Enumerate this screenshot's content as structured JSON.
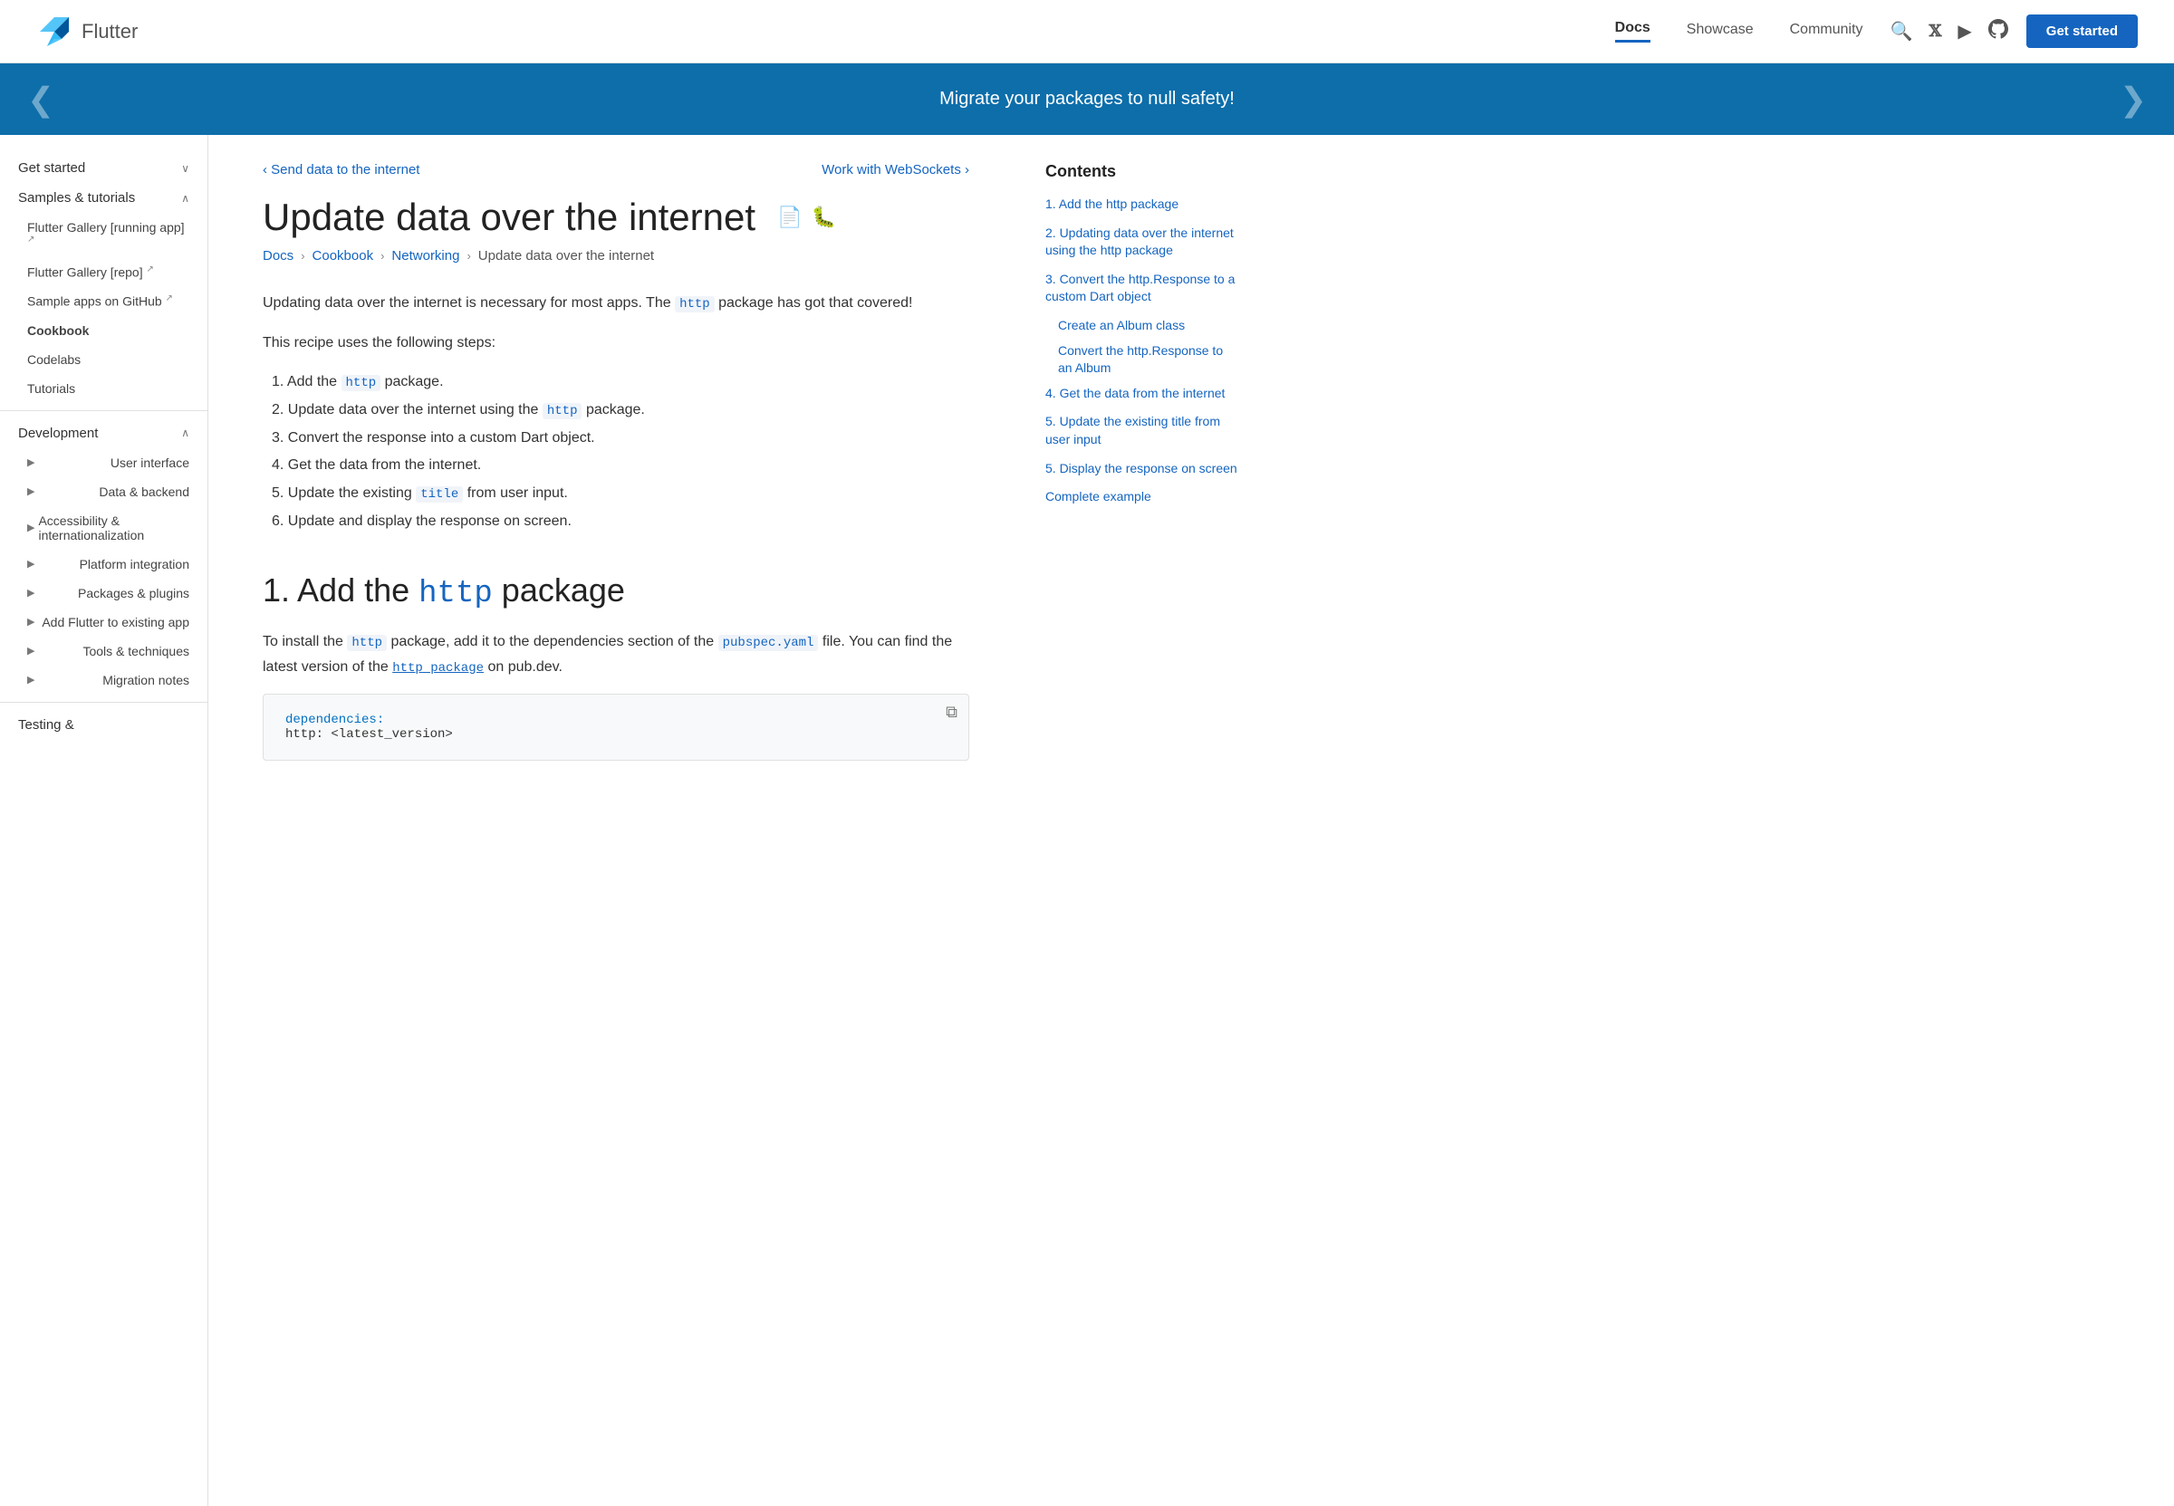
{
  "header": {
    "logo_text": "Flutter",
    "nav": [
      {
        "label": "Docs",
        "active": true,
        "id": "docs"
      },
      {
        "label": "Showcase",
        "active": false,
        "id": "showcase"
      },
      {
        "label": "Community",
        "active": false,
        "id": "community"
      }
    ],
    "get_started_label": "Get started"
  },
  "banner": {
    "text": "Migrate your packages to null safety!"
  },
  "sidebar": {
    "items": [
      {
        "label": "Get started",
        "type": "top",
        "expanded": false
      },
      {
        "label": "Samples & tutorials",
        "type": "top",
        "expanded": true
      },
      {
        "label": "Flutter Gallery [running app]",
        "type": "sub",
        "ext": true
      },
      {
        "label": "Flutter Gallery [repo]",
        "type": "sub",
        "ext": true
      },
      {
        "label": "Sample apps on GitHub",
        "type": "sub",
        "ext": true
      },
      {
        "label": "Cookbook",
        "type": "sub",
        "active": true
      },
      {
        "label": "Codelabs",
        "type": "sub"
      },
      {
        "label": "Tutorials",
        "type": "sub"
      },
      {
        "label": "Development",
        "type": "top",
        "expanded": true
      },
      {
        "label": "User interface",
        "type": "sub-arrow"
      },
      {
        "label": "Data & backend",
        "type": "sub-arrow"
      },
      {
        "label": "Accessibility & internationalization",
        "type": "sub-arrow"
      },
      {
        "label": "Platform integration",
        "type": "sub-arrow"
      },
      {
        "label": "Packages & plugins",
        "type": "sub-arrow"
      },
      {
        "label": "Add Flutter to existing app",
        "type": "sub-arrow"
      },
      {
        "label": "Tools & techniques",
        "type": "sub-arrow"
      },
      {
        "label": "Migration notes",
        "type": "sub-arrow"
      },
      {
        "label": "Testing &",
        "type": "top-partial"
      }
    ]
  },
  "page_nav": {
    "prev_label": "Send data to the internet",
    "next_label": "Work with WebSockets"
  },
  "page_title": "Update data over the internet",
  "breadcrumb": [
    {
      "label": "Docs",
      "href": "#"
    },
    {
      "label": "Cookbook",
      "href": "#"
    },
    {
      "label": "Networking",
      "href": "#"
    },
    {
      "label": "Update data over the internet",
      "current": true
    }
  ],
  "intro_text": "Updating data over the internet is necessary for most apps. The http package has got that covered!",
  "recipe_intro": "This recipe uses the following steps:",
  "steps": [
    "1. Add the http package.",
    "2. Update data over the internet using the http package.",
    "3. Convert the response into a custom Dart object.",
    "4. Get the data from the internet.",
    "5. Update the existing title from user input.",
    "6. Update and display the response on screen."
  ],
  "section1_title_prefix": "1. Add the ",
  "section1_title_code": "http",
  "section1_title_suffix": " package",
  "section1_text1_prefix": "To install the ",
  "section1_text1_code1": "http",
  "section1_text1_middle": " package, add it to the dependencies section of the ",
  "section1_text1_code2": "pubspec.yaml",
  "section1_text1_suffix": " file. You can find the latest version of the ",
  "section1_text1_code3": "http package",
  "section1_text1_end": " on pub.dev.",
  "code_block": {
    "line1": "dependencies:",
    "line2": "  http: <latest_version>"
  },
  "toc": {
    "title": "Contents",
    "items": [
      {
        "label": "1. Add the http package",
        "sub": false
      },
      {
        "label": "2. Updating data over the internet using the http package",
        "sub": false
      },
      {
        "label": "3. Convert the http.Response to a custom Dart object",
        "sub": false
      },
      {
        "label": "Create an Album class",
        "sub": true
      },
      {
        "label": "Convert the http.Response to an Album",
        "sub": true
      },
      {
        "label": "4. Get the data from the internet",
        "sub": false
      },
      {
        "label": "5. Update the existing title from user input",
        "sub": false
      },
      {
        "label": "5. Display the response on screen",
        "sub": false
      },
      {
        "label": "Complete example",
        "sub": false
      }
    ]
  },
  "icons": {
    "search": "🔍",
    "twitter": "𝕏",
    "youtube": "▶",
    "github": "⚙",
    "doc": "📄",
    "bug": "🐛",
    "copy": "⧉",
    "chevron_down": "∨",
    "chevron_right": "›",
    "chevron_left": "‹",
    "arrow_right": "▶",
    "ext_link": "↗"
  }
}
